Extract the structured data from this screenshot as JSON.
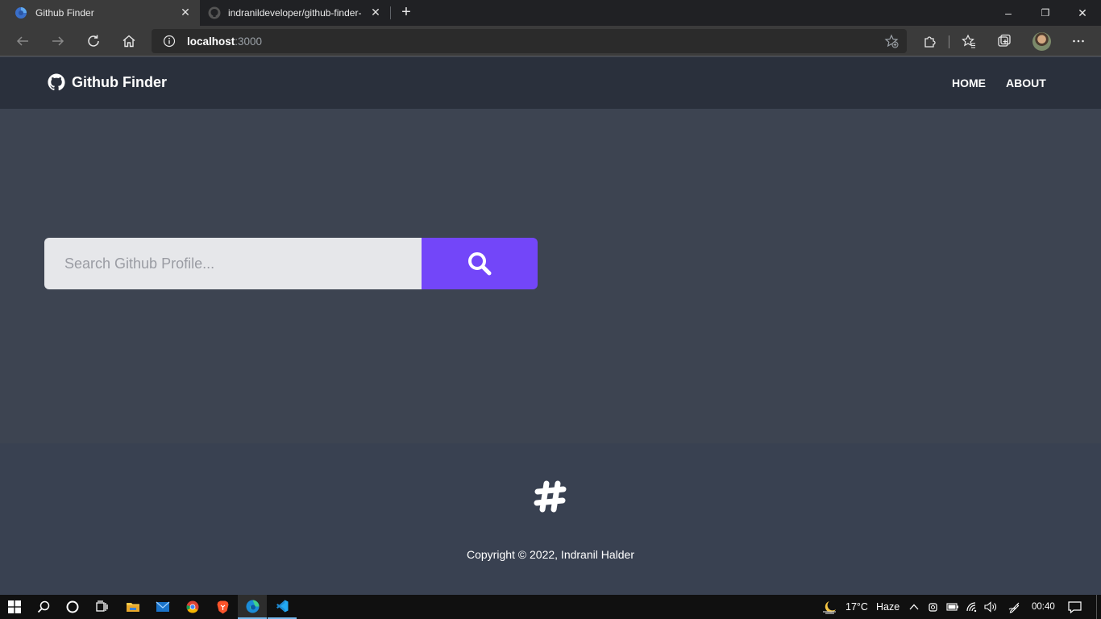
{
  "browser": {
    "tabs": [
      {
        "title": "Github Finder",
        "active": true,
        "icon": "edge-globe-icon"
      },
      {
        "title": "indranildeveloper/github-finder-",
        "active": false,
        "icon": "github-icon"
      }
    ],
    "address": {
      "host": "localhost",
      "port": ":3000"
    },
    "window_controls": {
      "minimize": "–",
      "restore": "❐",
      "close": "✕"
    }
  },
  "navbar": {
    "brand": "Github Finder",
    "links": [
      "HOME",
      "ABOUT"
    ]
  },
  "search": {
    "placeholder": "Search Github Profile...",
    "value": ""
  },
  "footer": {
    "copyright": "Copyright © 2022, Indranil Halder"
  },
  "taskbar": {
    "weather_temp": "17°C",
    "weather_desc": "Haze",
    "clock": "00:40"
  },
  "colors": {
    "accent": "#7346f9",
    "navbar_bg": "#2a303c",
    "main_bg": "#3d4451",
    "footer_bg": "#394151"
  }
}
